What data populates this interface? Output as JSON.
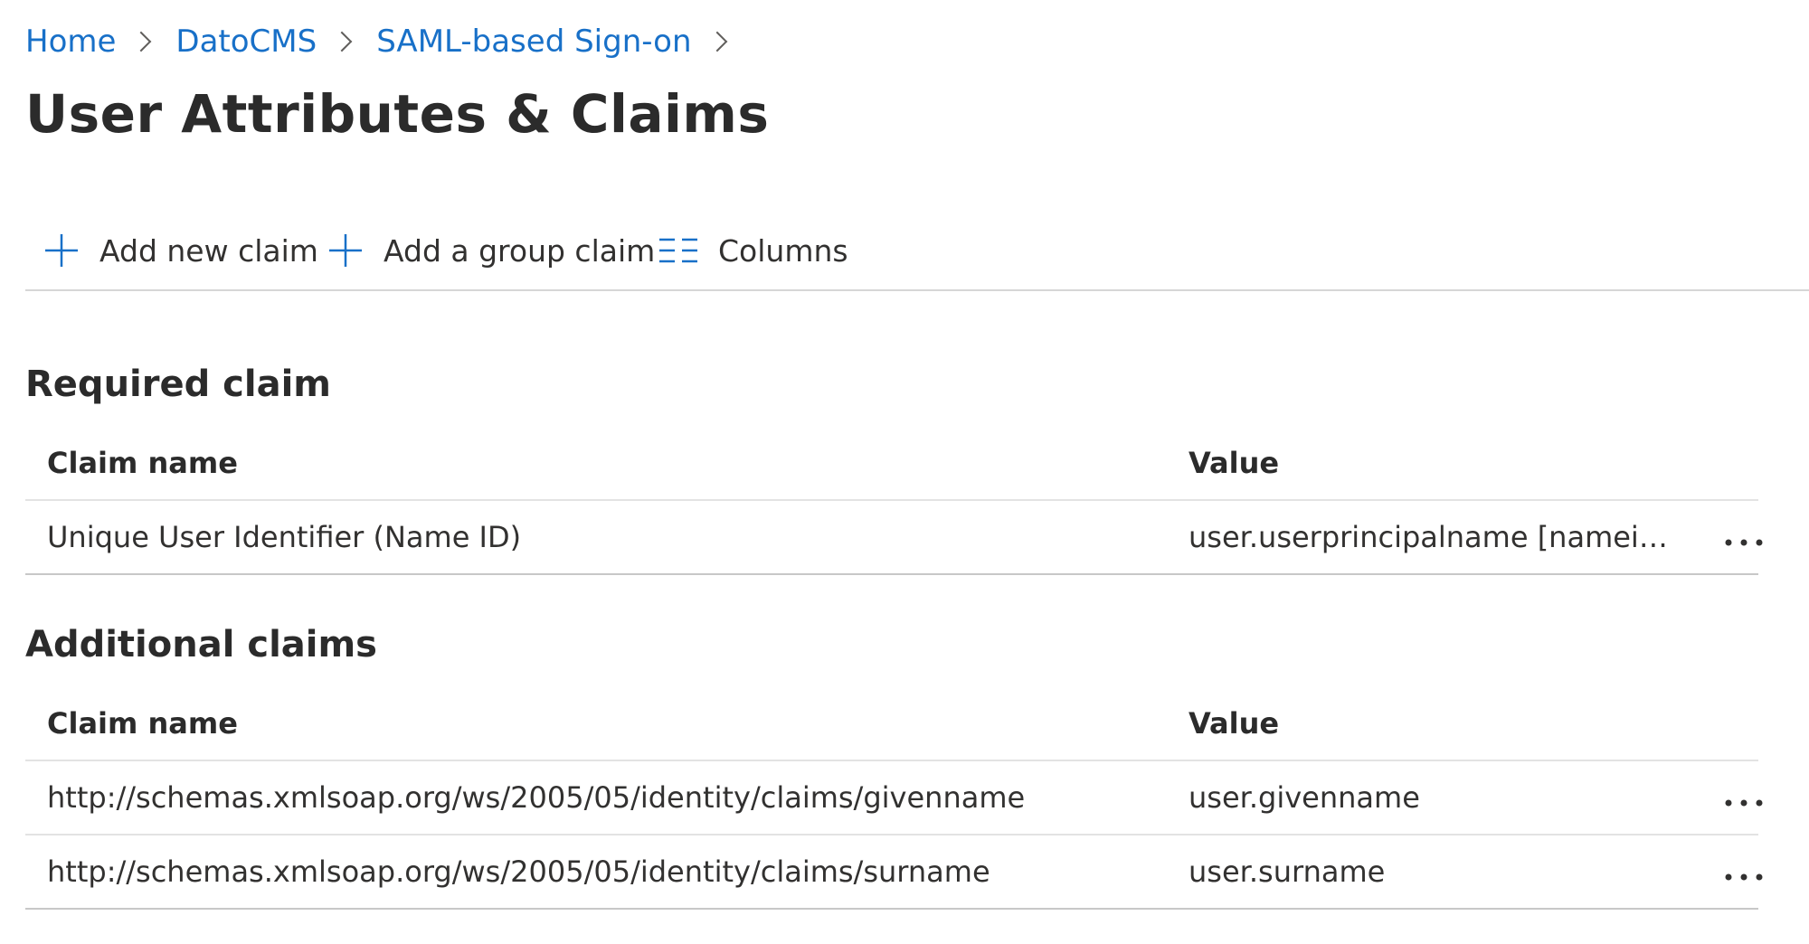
{
  "breadcrumb": {
    "items": [
      {
        "label": "Home"
      },
      {
        "label": "DatoCMS"
      },
      {
        "label": "SAML-based Sign-on"
      }
    ]
  },
  "page": {
    "title": "User Attributes & Claims"
  },
  "toolbar": {
    "add_claim_label": "Add new claim",
    "add_group_claim_label": "Add a group claim",
    "columns_label": "Columns",
    "icons": {
      "add_claim": "plus-icon",
      "add_group_claim": "plus-icon",
      "columns": "columns-icon"
    }
  },
  "required_claim": {
    "title": "Required claim",
    "headers": {
      "name": "Claim name",
      "value": "Value"
    },
    "rows": [
      {
        "name": "Unique User Identifier (Name ID)",
        "value": "user.userprincipalname [nameid-for..."
      }
    ]
  },
  "additional_claims": {
    "title": "Additional claims",
    "headers": {
      "name": "Claim name",
      "value": "Value"
    },
    "rows": [
      {
        "name": "http://schemas.xmlsoap.org/ws/2005/05/identity/claims/givenname",
        "value": "user.givenname"
      },
      {
        "name": "http://schemas.xmlsoap.org/ws/2005/05/identity/claims/surname",
        "value": "user.surname"
      }
    ]
  },
  "colors": {
    "link": "#1870c8",
    "text": "#323130",
    "accent_icon": "#1870c8"
  }
}
